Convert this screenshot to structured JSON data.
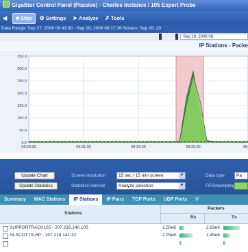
{
  "window": {
    "title": "GigaStor Control Panel (Passive) - Charles Instance / 105 Expert Probe"
  },
  "toolbar": {
    "items": [
      {
        "label": "",
        "icon": "back-icon"
      },
      {
        "label": "Stop",
        "icon": "stop-icon",
        "active": true
      },
      {
        "label": "Settings",
        "icon": "gear-icon"
      },
      {
        "label": "Analyze",
        "icon": "analyze-icon"
      },
      {
        "label": "Tools",
        "icon": "tools-icon"
      }
    ]
  },
  "daterange": {
    "text": "Data Range: Sep 27, 2006 08:43:30 - Sep 28, 2006 09:17:36    Screen: Sep 28, 20"
  },
  "range_dropdown": "Sep 28, 2006 08:",
  "chart_header": "IP Stations - Packe",
  "chart_data": {
    "type": "area",
    "title": "IP Stations - Packe",
    "xlabel": "",
    "ylabel": "",
    "y_ticks": [
      "350.0",
      "300.0",
      "250.0",
      "200.0",
      "150.0",
      "100.0",
      "50.0",
      "0.0"
    ],
    "x_ticks": [
      "08:29:30",
      "08:31:30",
      "08:33:30",
      "08:35:30",
      "08:37"
    ],
    "ylim": [
      0,
      350
    ],
    "grid": true,
    "series": [
      {
        "x": [
          0,
          1,
          2,
          3,
          4,
          5,
          6,
          7,
          8,
          9,
          10,
          11,
          12,
          13,
          14,
          15,
          16,
          17,
          18,
          19,
          20,
          21,
          22,
          23,
          24,
          25,
          26,
          27,
          28,
          29,
          30,
          31,
          32
        ],
        "values": [
          3,
          3,
          3,
          3,
          3,
          3,
          3,
          3,
          3,
          3,
          3,
          3,
          3,
          3,
          3,
          3,
          3,
          3,
          3,
          3,
          3,
          3,
          3,
          180,
          290,
          120,
          8,
          3,
          3,
          3,
          3,
          3,
          3
        ]
      },
      {
        "x": [
          0,
          1,
          2,
          3,
          4,
          5,
          6,
          7,
          8,
          9,
          10,
          11,
          12,
          13,
          14,
          15,
          16,
          17,
          18,
          19,
          20,
          21,
          22,
          23,
          24,
          25,
          26,
          27,
          28,
          29,
          30,
          31,
          32
        ],
        "values": [
          2,
          2,
          2,
          2,
          2,
          2,
          2,
          2,
          2,
          2,
          2,
          2,
          2,
          2,
          2,
          2,
          2,
          2,
          2,
          2,
          2,
          2,
          2,
          150,
          270,
          170,
          6,
          2,
          2,
          2,
          2,
          2,
          2
        ]
      }
    ],
    "highlight_band_x": [
      21.5,
      25.5
    ],
    "colors": {
      "series1": "#2f8a3a",
      "series2": "#8fd66a",
      "band": "#f4c8cc",
      "grid": "#c9d2e2"
    }
  },
  "controls": {
    "update_chart": "Update Chart",
    "update_statistics": "Update Statistics",
    "screen_resolution_label": "Screen resolution",
    "screen_resolution_value": "15 sec / 15 min screen",
    "statistics_interval_label": "Statistics interval",
    "statistics_interval_value": "Analyze selection",
    "data_type_label": "Data type",
    "data_type_value": "Pa",
    "fifo_label": "FIFO/sampling"
  },
  "tabs": [
    {
      "label": "Summary",
      "active": false
    },
    {
      "label": "MAC Stations",
      "active": false
    },
    {
      "label": "IP Stations",
      "active": true
    },
    {
      "label": "IP Pairs",
      "active": false
    },
    {
      "label": "TCP Ports",
      "active": false
    },
    {
      "label": "UDP Ports",
      "active": false
    },
    {
      "label": "V",
      "active": false
    }
  ],
  "table": {
    "headers": {
      "stations": "Stations",
      "packets": "Packets",
      "rx": "Rx",
      "tx": "Tx"
    },
    "rows": [
      {
        "station": "SUPPORTRACK105 - 207.218.140.105",
        "rx": "1.50e6",
        "tx": "2.93e6",
        "rx_level": 0.2,
        "tx_level": 0.7
      },
      {
        "station": "NI-SCOTTS-HP - 207.218.141.32",
        "rx": "2.93e6",
        "tx": "1.49e6",
        "rx_level": 0.55,
        "tx_level": 0.3
      },
      {
        "station": "",
        "rx": "",
        "tx": "",
        "rx_level": 0.1,
        "tx_level": 0.1
      }
    ]
  }
}
